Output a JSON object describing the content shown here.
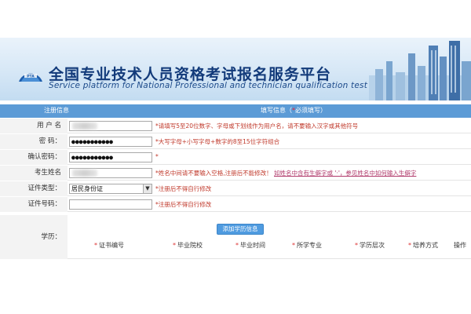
{
  "header": {
    "title": "全国专业技术人员资格考试报名服务平台",
    "subtitle": "Service platform for National Professional and technician  qualification test",
    "logo_icon": "pta-logo"
  },
  "section_bar": {
    "left_label": "注册信息",
    "right_label_prefix": "填写信息（",
    "required_star": "*",
    "right_label_required": "必须填写",
    "right_label_suffix": "）"
  },
  "form": {
    "username": {
      "label": "用 户 名",
      "value": "",
      "hint": "*请填写5至20位数字、字母或下划线作为用户名，请不要输入汉字或其他符号"
    },
    "password": {
      "label": "密    码：",
      "value": "●●●●●●●●●●●",
      "hint": "*大写字母+小写字母+数字的8至15位字符组合"
    },
    "confirm_password": {
      "label": "确认密码：",
      "value": "●●●●●●●●●●●",
      "hint": "*"
    },
    "name": {
      "label": "考生姓名",
      "value": "",
      "hint": "*姓名中间请不要输入空格,注册后不能修改！",
      "hint_link": "如姓名中含有生僻字或 '·'，参见姓名中如何输入生僻字"
    },
    "id_type": {
      "label": "证件类型：",
      "value": "居民身份证",
      "hint": "*注册后不得自行修改"
    },
    "id_number": {
      "label": "证件号码：",
      "value": "",
      "hint": "*注册后不得自行修改"
    }
  },
  "education": {
    "label": "学历：",
    "add_button": "添加学历信息",
    "columns": [
      {
        "label": "证书编号",
        "required": true
      },
      {
        "label": "毕业院校",
        "required": true
      },
      {
        "label": "毕业时间",
        "required": true
      },
      {
        "label": "所学专业",
        "required": true
      },
      {
        "label": "学历层次",
        "required": true
      },
      {
        "label": "培养方式",
        "required": true
      },
      {
        "label": "操作",
        "required": false
      }
    ]
  },
  "colors": {
    "bar": "#5c9bd6",
    "title": "#123a7a",
    "hint": "#c0392b",
    "button": "#4f9be0"
  }
}
